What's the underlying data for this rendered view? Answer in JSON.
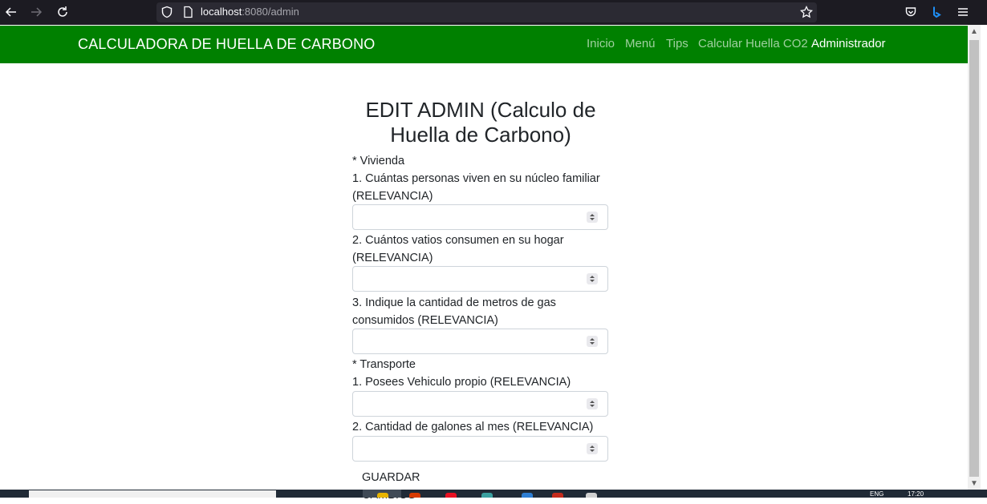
{
  "browser": {
    "url_host": "localhost",
    "url_rest": ":8080/admin"
  },
  "navbar": {
    "brand": "CALCULADORA DE HUELLA DE CARBONO",
    "links": [
      {
        "label": "Inicio",
        "active": false
      },
      {
        "label": "Menú",
        "active": false
      },
      {
        "label": "Tips",
        "active": false
      },
      {
        "label": "Calcular Huella CO2",
        "active": false
      },
      {
        "label": "Administrador",
        "active": true
      }
    ]
  },
  "page": {
    "title_line1": "EDIT ADMIN (Calculo de",
    "title_line2": "Huella de Carbono)"
  },
  "form": {
    "section_vivienda": "* Vivienda",
    "q1": "1. Cuántas personas viven en su núcleo familiar (RELEVANCIA)",
    "q1_value": "",
    "q2": "2. Cuántos vatios consumen en su hogar (RELEVANCIA)",
    "q2_value": "",
    "q3": "3. Indique la cantidad de metros de gas consumidos (RELEVANCIA)",
    "q3_value": "",
    "section_transporte": "* Transporte",
    "t1": "1. Posees Vehiculo propio (RELEVANCIA)",
    "t1_value": "",
    "t2": "2. Cantidad de galones al mes (RELEVANCIA)",
    "t2_value": "",
    "save_label": "GUARDAR CAMBIOS"
  },
  "taskbar": {
    "lang": "ENG",
    "time": "17:20"
  },
  "colors": {
    "navbar": "#008000",
    "browser_chrome": "#1c1b22"
  }
}
